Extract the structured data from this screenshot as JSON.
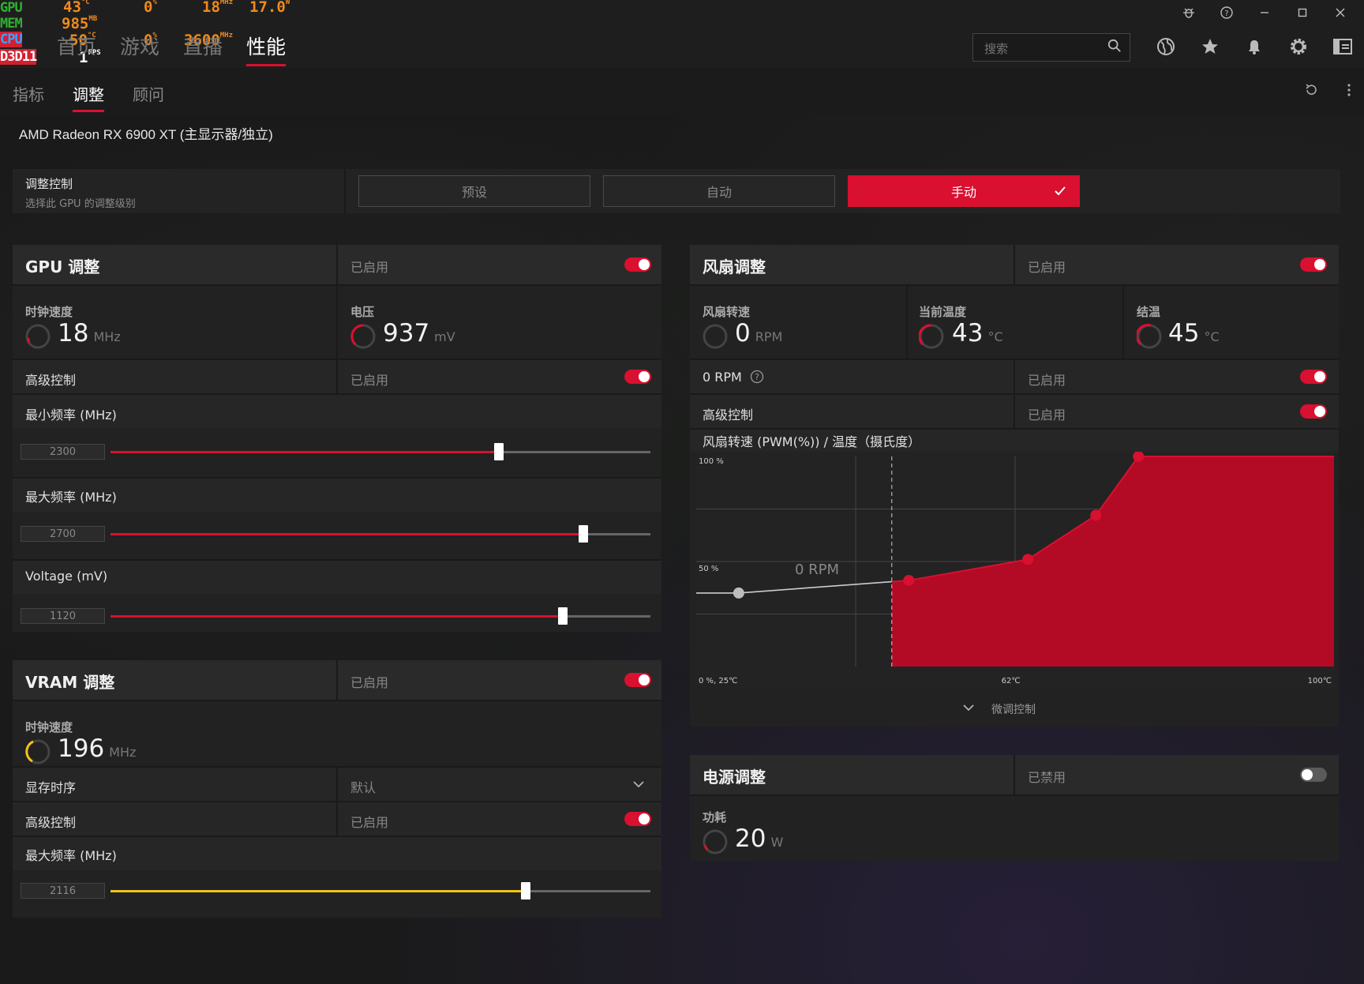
{
  "overlay": {
    "gpu_label": "GPU",
    "mem_label": "MEM",
    "cpu_label": "CPU",
    "api_label": "D3D11",
    "gpu_temp": "43",
    "gpu_temp_unit": "°C",
    "gpu_load": "0",
    "gpu_load_unit": "%",
    "gpu_clock": "18",
    "gpu_clock_unit": "MHz",
    "gpu_power": "17.0",
    "gpu_power_unit": "W",
    "mem_used": "985",
    "mem_unit": "MB",
    "cpu_temp": "50",
    "cpu_temp_unit": "°C",
    "cpu_load": "0",
    "cpu_load_unit": "%",
    "cpu_clock": "3600",
    "cpu_clock_unit": "MHz",
    "fps": "1",
    "fps_unit": "FPS"
  },
  "nav": {
    "tabs": [
      "首页",
      "游戏",
      "直播",
      "性能"
    ],
    "active_index": 3,
    "search_placeholder": "搜索"
  },
  "subnav": {
    "tabs": [
      "指标",
      "调整",
      "顾问"
    ],
    "active_index": 1
  },
  "device_name": "AMD Radeon RX 6900 XT (主显示器/独立)",
  "tuning_control": {
    "title": "调整控制",
    "subtitle": "选择此 GPU 的调整级别",
    "options": [
      "预设",
      "自动",
      "手动"
    ],
    "selected": "手动"
  },
  "gpu_tuning": {
    "title": "GPU 调整",
    "status": "已启用",
    "clock_label": "时钟速度",
    "clock_value": "18",
    "clock_unit": "MHz",
    "voltage_label": "电压",
    "voltage_value": "937",
    "voltage_unit": "mV",
    "advanced_label": "高级控制",
    "advanced_status": "已启用",
    "min_freq_label": "最小频率 (MHz)",
    "min_freq_value": "2300",
    "min_freq_fraction": 0.72,
    "max_freq_label": "最大频率 (MHz)",
    "max_freq_value": "2700",
    "max_freq_fraction": 0.875,
    "voltage_ctrl_label": "Voltage (mV)",
    "voltage_ctrl_value": "1120",
    "voltage_ctrl_fraction": 0.838
  },
  "vram_tuning": {
    "title": "VRAM 调整",
    "status": "已启用",
    "clock_label": "时钟速度",
    "clock_value": "196",
    "clock_unit": "MHz",
    "timing_label": "显存时序",
    "timing_value": "默认",
    "advanced_label": "高级控制",
    "advanced_status": "已启用",
    "max_freq_label": "最大频率 (MHz)",
    "max_freq_value": "2116",
    "max_freq_fraction": 0.769
  },
  "fan_tuning": {
    "title": "风扇调整",
    "status": "已启用",
    "fan_speed_label": "风扇转速",
    "fan_speed_value": "0",
    "fan_speed_unit": "RPM",
    "temp_label": "当前温度",
    "temp_value": "43",
    "temp_unit": "°C",
    "junction_label": "结温",
    "junction_value": "45",
    "junction_unit": "°C",
    "zero_rpm_label": "0 RPM",
    "zero_rpm_status": "已启用",
    "advanced_label": "高级控制",
    "advanced_status": "已启用",
    "curve_title": "风扇转速 (PWM(%)) / 温度（摄氏度）",
    "fine_control_label": "微调控制"
  },
  "chart_data": {
    "type": "area",
    "title": "风扇转速 (PWM(%)) / 温度（摄氏度）",
    "xlabel": "",
    "ylabel": "",
    "y_tick_labels": [
      "100 %",
      "50 %",
      "0 %, 25℃"
    ],
    "x_tick_labels": [
      "62℃",
      "100℃"
    ],
    "zero_rpm_label": "0 RPM",
    "xlim": [
      25,
      100
    ],
    "ylim": [
      0,
      100
    ],
    "zero_rpm_threshold": 48,
    "series": [
      {
        "x": [
          25,
          30,
          50,
          64,
          72,
          77,
          100
        ],
        "values": [
          35,
          35,
          41,
          51,
          72,
          100,
          100
        ]
      }
    ],
    "grid": true,
    "fill_color": "#b30a26",
    "line_color": "#d9102f"
  },
  "power_tuning": {
    "title": "电源调整",
    "status": "已禁用",
    "power_label": "功耗",
    "power_value": "20",
    "power_unit": "W"
  },
  "colors": {
    "accent": "#d9102f",
    "vram_accent": "#f2c21b"
  }
}
